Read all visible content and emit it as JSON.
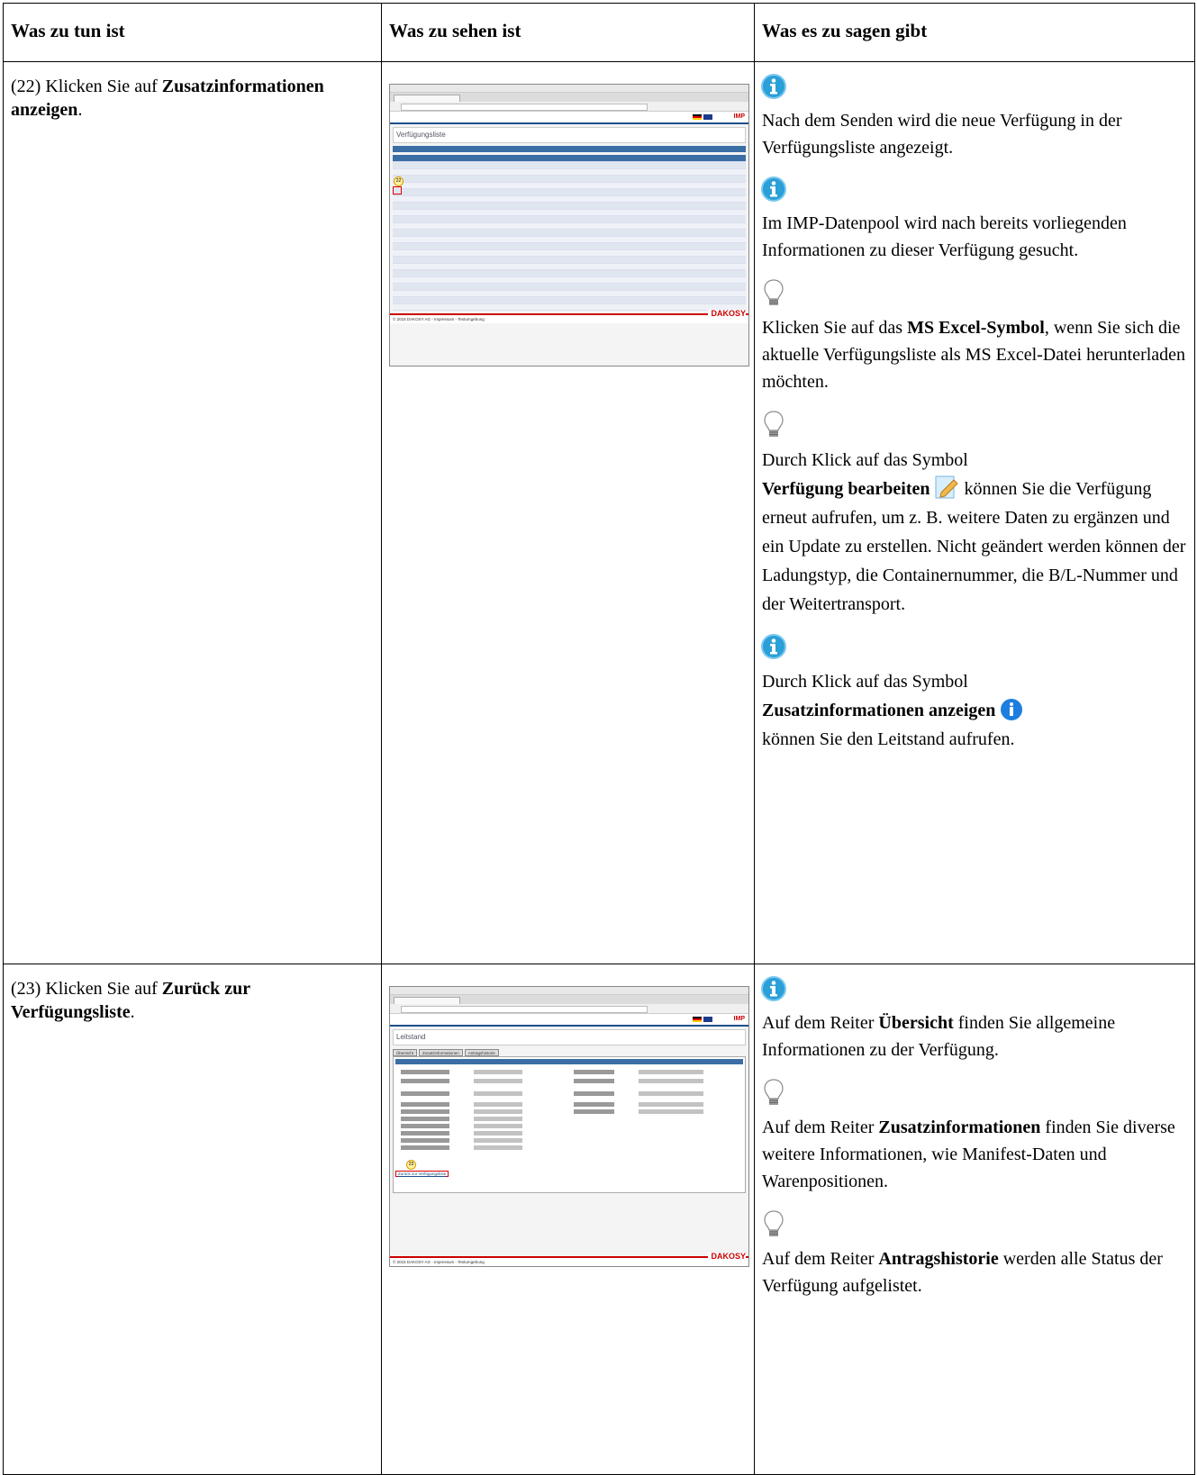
{
  "header": {
    "col1": "Was zu tun ist",
    "col2": "Was zu sehen ist",
    "col3": "Was es zu sagen gibt"
  },
  "rows": [
    {
      "step_prefix": "(22) Klicken Sie auf ",
      "step_bold": "Zusatzinformationen anzeigen",
      "step_suffix": ".",
      "screenshot": {
        "marker": "22",
        "footer": "© 2015 DAKOSY AG - Impressum - Testumgebung",
        "brand": "DAKOSY",
        "page_title": "Verfügungsliste"
      },
      "notes": {
        "n1": "Nach dem Senden wird die neue Verfügung in der Verfügungsliste angezeigt.",
        "n2": "Im IMP-Datenpool wird nach bereits vorliegenden Informationen zu dieser Verfügung gesucht.",
        "n3_a": "Klicken Sie auf das ",
        "n3_b": "MS Excel-Symbol",
        "n3_c": ", wenn Sie sich die aktuelle Verfügungsliste als MS Excel-Datei herunterladen möchten.",
        "n4_a": "Durch Klick auf das Symbol",
        "n4_b": "Verfügung bearbeiten",
        "n4_c": " können Sie die Verfügung erneut aufrufen, um z. B. weitere Daten zu ergänzen und ein Update zu erstellen. Nicht geändert werden können der Ladungstyp, die Containernummer, die B/L-Nummer und der Weitertransport.",
        "n5_a": "Durch Klick auf das Symbol",
        "n5_b": "Zusatzinformationen anzeigen",
        "n5_c": "können Sie den Leitstand aufrufen."
      }
    },
    {
      "step_prefix": "(23) Klicken Sie auf ",
      "step_bold": "Zurück zur Verfügungsliste",
      "step_suffix": ".",
      "screenshot": {
        "marker": "23",
        "footer": "© 2015 DAKOSY AG - Impressum - Testumgebung",
        "brand": "DAKOSY",
        "page_title": "Leitstand",
        "tabs": [
          "Übersicht",
          "Zusatzinformationen",
          "Antragshistorie"
        ],
        "back_link": "Zurück zur Verfügungsliste"
      },
      "notes": {
        "n1_a": "Auf dem Reiter ",
        "n1_b": "Übersicht",
        "n1_c": " finden Sie allgemeine Informationen zu der Verfügung.",
        "n2_a": "Auf dem Reiter ",
        "n2_b": "Zusatzinformationen",
        "n2_c": " finden Sie diverse weitere Informationen, wie Manifest-Daten und Warenpositionen.",
        "n3_a": "Auf dem Reiter ",
        "n3_b": "Antragshistorie",
        "n3_c": " werden alle Status der Verfügung aufgelistet."
      }
    }
  ]
}
